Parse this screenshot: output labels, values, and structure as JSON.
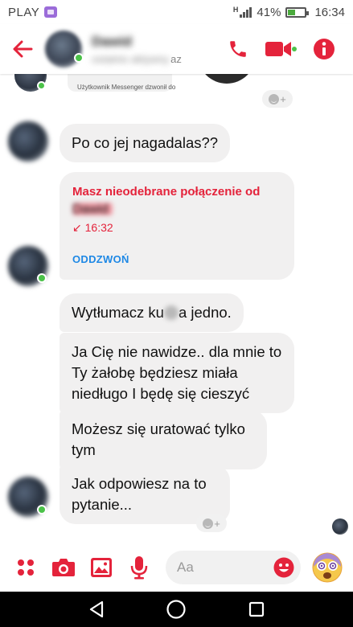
{
  "status_bar": {
    "carrier": "PLAY",
    "network": "H",
    "battery": "41%",
    "time": "16:34"
  },
  "header": {
    "contact_name": "Dawid",
    "status_line": "ostatnio aktywny",
    "status_suffix": "az",
    "icons": [
      "back-arrow-icon",
      "phone-icon",
      "video-camera-icon",
      "info-icon"
    ]
  },
  "top_partial": {
    "card_text": "Użytkownik Messenger dzwonił do"
  },
  "messages": [
    {
      "text": "Po co jej nagadalas??"
    },
    {
      "text_before": "Wytłumacz ku",
      "text_after": "a jedno."
    },
    {
      "text": "Ja Cię nie nawidze.. dla mnie to Ty żałobę będziesz miała niedługo I będę się cieszyć"
    },
    {
      "text": "Możesz się uratować tylko tym"
    },
    {
      "text": "Jak odpowiesz  na to pytanie..."
    }
  ],
  "missed_call": {
    "title": "Masz nieodebrane połączenie od",
    "caller": "Dawid",
    "time": "16:32",
    "action": "ODDZWOŃ"
  },
  "reactions": {
    "add_label": "+"
  },
  "composer": {
    "placeholder": "Aa",
    "icons": [
      "apps-icon",
      "camera-icon",
      "image-icon",
      "microphone-icon",
      "emoji-icon",
      "astonished-face-icon"
    ]
  },
  "colors": {
    "accent": "#e4233b",
    "link": "#1e88e5",
    "bubble": "#f1f0f0",
    "online": "#4bc249"
  }
}
